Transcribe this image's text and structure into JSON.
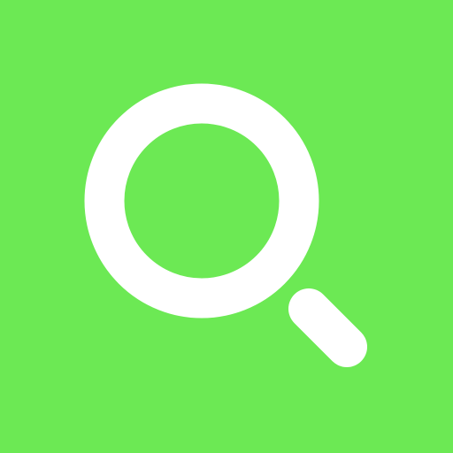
{
  "icon": {
    "name": "search-icon",
    "background_color": "#6ce954",
    "glyph_color": "#ffffff"
  }
}
